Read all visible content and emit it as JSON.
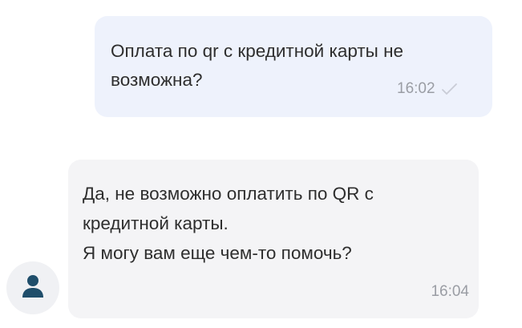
{
  "messages": [
    {
      "direction": "outgoing",
      "text": "Оплата по qr с кредитной карты не возможна?",
      "time": "16:02",
      "status_icon": "check-icon"
    },
    {
      "direction": "incoming",
      "lines": [
        "Да, не возможно оплатить по QR с",
        "кредитной карты.",
        "Я могу вам еще чем-то помочь?"
      ],
      "time": "16:04",
      "avatar_icon": "user-icon"
    }
  ],
  "colors": {
    "outgoing_bubble": "#eef2fc",
    "incoming_bubble": "#f4f4f6",
    "avatar_icon": "#1f4e6b",
    "time_text": "#9a9da4"
  }
}
